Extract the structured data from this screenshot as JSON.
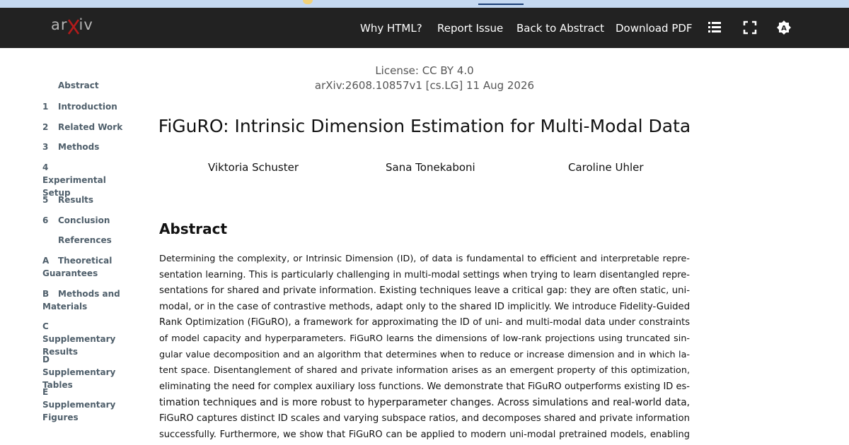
{
  "navbar": {
    "logo_text": "arXiv",
    "links": [
      "Why HTML?",
      "Report Issue",
      "Back to Abstract",
      "Download PDF"
    ],
    "icons": [
      "list-icon",
      "fullscreen-icon",
      "theme-toggle-icon"
    ]
  },
  "toc": {
    "items": [
      {
        "num": "",
        "label": "Abstract"
      },
      {
        "num": "1",
        "label": "Introduction"
      },
      {
        "num": "2",
        "label": "Related Work"
      },
      {
        "num": "3",
        "label": "Methods"
      },
      {
        "num": "4",
        "label": "Experimental Setup"
      },
      {
        "num": "5",
        "label": "Results"
      },
      {
        "num": "6",
        "label": "Conclusion"
      },
      {
        "num": "",
        "label": "References"
      },
      {
        "num": "A",
        "label": "Theoretical Guarantees"
      },
      {
        "num": "B",
        "label": "Methods and Materials"
      },
      {
        "num": "C",
        "label": "Supplementary Results"
      },
      {
        "num": "D",
        "label": "Supplementary Tables"
      },
      {
        "num": "E",
        "label": "Supplementary Figures"
      }
    ]
  },
  "paper": {
    "license": "License: CC BY 4.0",
    "arxiv_id": "arXiv:2608.10857v1 [cs.LG] 11 Aug 2026",
    "title": "FiGuRO: Intrinsic Dimension Estimation for Multi-Modal Data",
    "authors": [
      "Viktoria Schuster",
      "Sana Tonekaboni",
      "Caroline Uhler"
    ],
    "abstract_heading": "Abstract",
    "abstract_lines": [
      "Determining the complexity, or Intrinsic Dimension (ID), of data is fundamental to efficient and interpretable repre-",
      "sentation learning. This is particularly challenging in multi-modal settings when trying to learn disentangled repre-",
      "sentations for shared and private information. Existing techniques leave a critical gap: they are often static, uni-",
      "modal, or in the case of contrastive methods, adapt only to the shared ID implicitly. We introduce Fidelity-Guided",
      "Rank Optimization (FiGuRO), a framework for approximating the ID of uni- and multi-modal data under constraints",
      "of model capacity and hyperparameters. FiGuRO learns the dimensions of low-rank projections using truncated sin-",
      "gular value decomposition and an algorithm that determines when to reduce or increase dimension and in which la-",
      "tent space. Disentanglement of shared and private information arises as an emergent property of this optimization,",
      "eliminating the need for complex auxiliary loss functions. We demonstrate that FiGuRO outperforms existing ID es-",
      "timation techniques and is more robust to hyperparameter changes. Across simulations and real-world data,",
      "FiGuRO captures distinct ID scales and varying subspace ratios, and decomposes shared and private information",
      "successfully. Furthermore, we show that FiGuRO can be applied to modern uni-modal pretrained models, enabling"
    ]
  }
}
